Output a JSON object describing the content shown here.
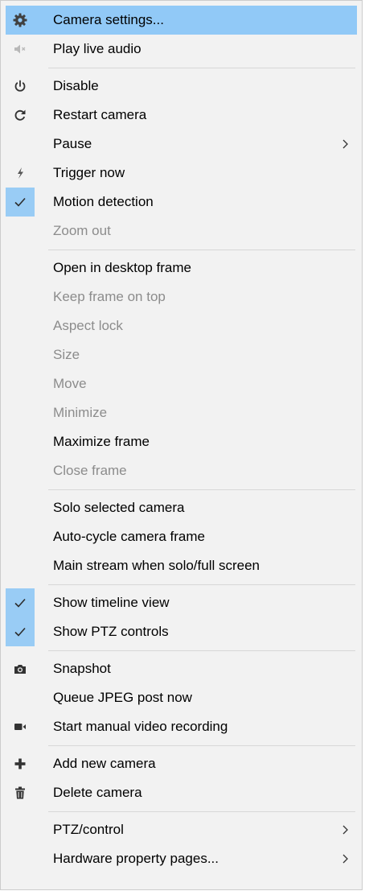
{
  "menu": {
    "items": [
      {
        "label": "Camera settings...",
        "icon": "gear-icon"
      },
      {
        "label": "Play live audio",
        "icon": "speaker-muted-icon"
      },
      {
        "label": "Disable",
        "icon": "power-icon"
      },
      {
        "label": "Restart camera",
        "icon": "refresh-icon"
      },
      {
        "label": "Pause"
      },
      {
        "label": "Trigger now",
        "icon": "lightning-icon"
      },
      {
        "label": "Motion detection",
        "icon": "checkmark-icon"
      },
      {
        "label": "Zoom out"
      },
      {
        "label": "Open in desktop frame"
      },
      {
        "label": "Keep frame on top"
      },
      {
        "label": "Aspect lock"
      },
      {
        "label": "Size"
      },
      {
        "label": "Move"
      },
      {
        "label": "Minimize"
      },
      {
        "label": "Maximize frame"
      },
      {
        "label": "Close frame"
      },
      {
        "label": "Solo selected camera"
      },
      {
        "label": "Auto-cycle camera frame"
      },
      {
        "label": "Main stream when solo/full screen"
      },
      {
        "label": "Show timeline view",
        "icon": "checkmark-icon"
      },
      {
        "label": "Show PTZ controls",
        "icon": "checkmark-icon"
      },
      {
        "label": "Snapshot",
        "icon": "camera-icon"
      },
      {
        "label": "Queue JPEG post now"
      },
      {
        "label": "Start manual video recording",
        "icon": "video-camera-icon"
      },
      {
        "label": "Add new camera",
        "icon": "plus-icon"
      },
      {
        "label": "Delete camera",
        "icon": "trash-icon"
      },
      {
        "label": "PTZ/control"
      },
      {
        "label": "Hardware property pages..."
      }
    ]
  },
  "colors": {
    "menu_background": "#f2f2f2",
    "highlight": "#91c9f7",
    "check_background": "#99ccf5",
    "disabled_text": "#8c8c8c",
    "separator": "#d7d7d7"
  }
}
